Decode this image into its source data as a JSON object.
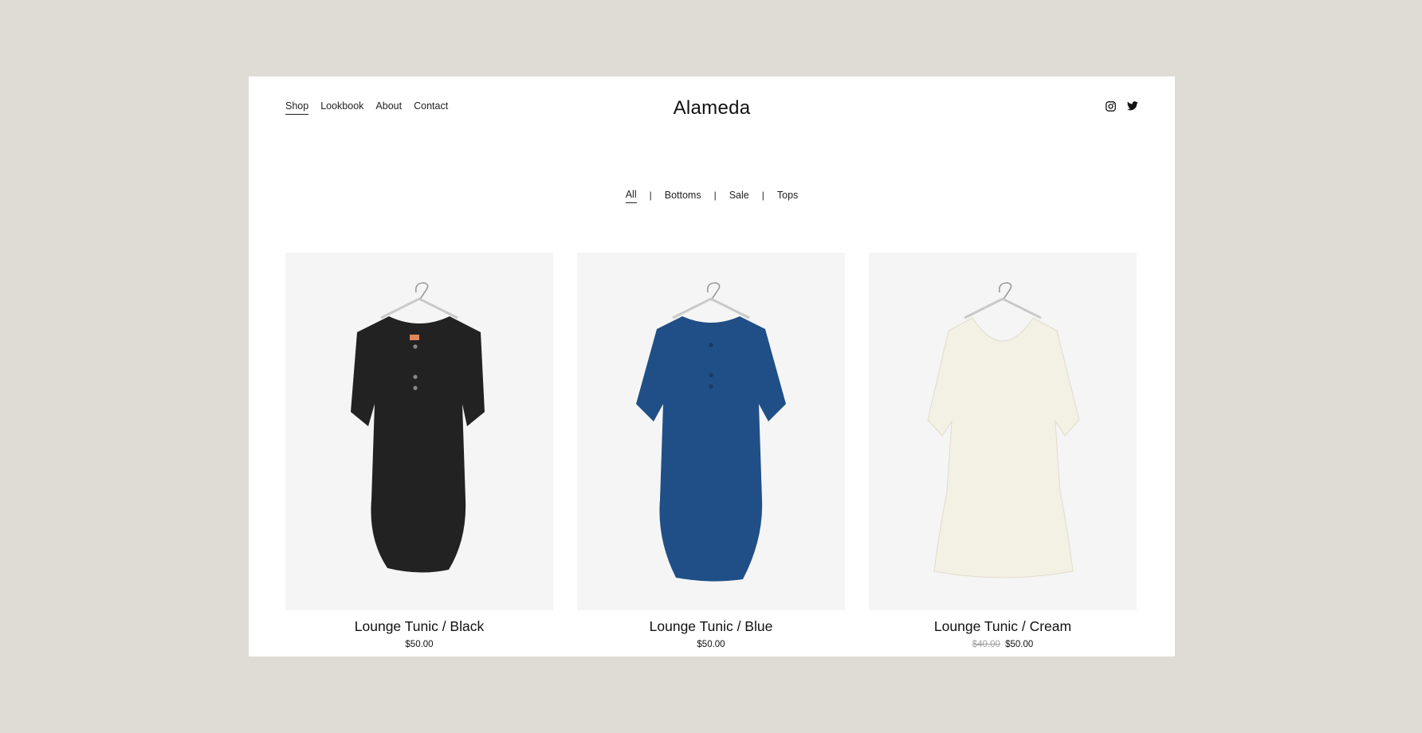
{
  "nav": {
    "links": [
      "Shop",
      "Lookbook",
      "About",
      "Contact"
    ],
    "active": "Shop"
  },
  "brand": "Alameda",
  "social": [
    "instagram-icon",
    "twitter-icon"
  ],
  "filters": {
    "items": [
      "All",
      "Bottoms",
      "Sale",
      "Tops"
    ],
    "separator": "|",
    "active": "All"
  },
  "products": [
    {
      "name": "Lounge Tunic / Black",
      "price": "$50.00",
      "old_price": "",
      "color": "#222222"
    },
    {
      "name": "Lounge Tunic / Blue",
      "price": "$50.00",
      "old_price": "",
      "color": "#1f4f86"
    },
    {
      "name": "Lounge Tunic / Cream",
      "price": "$50.00",
      "old_price": "$40.00",
      "color": "#f3f0e4"
    }
  ],
  "colors": {
    "background": "#dfdcd6",
    "page": "#ffffff",
    "image_bg": "#f5f5f5"
  }
}
